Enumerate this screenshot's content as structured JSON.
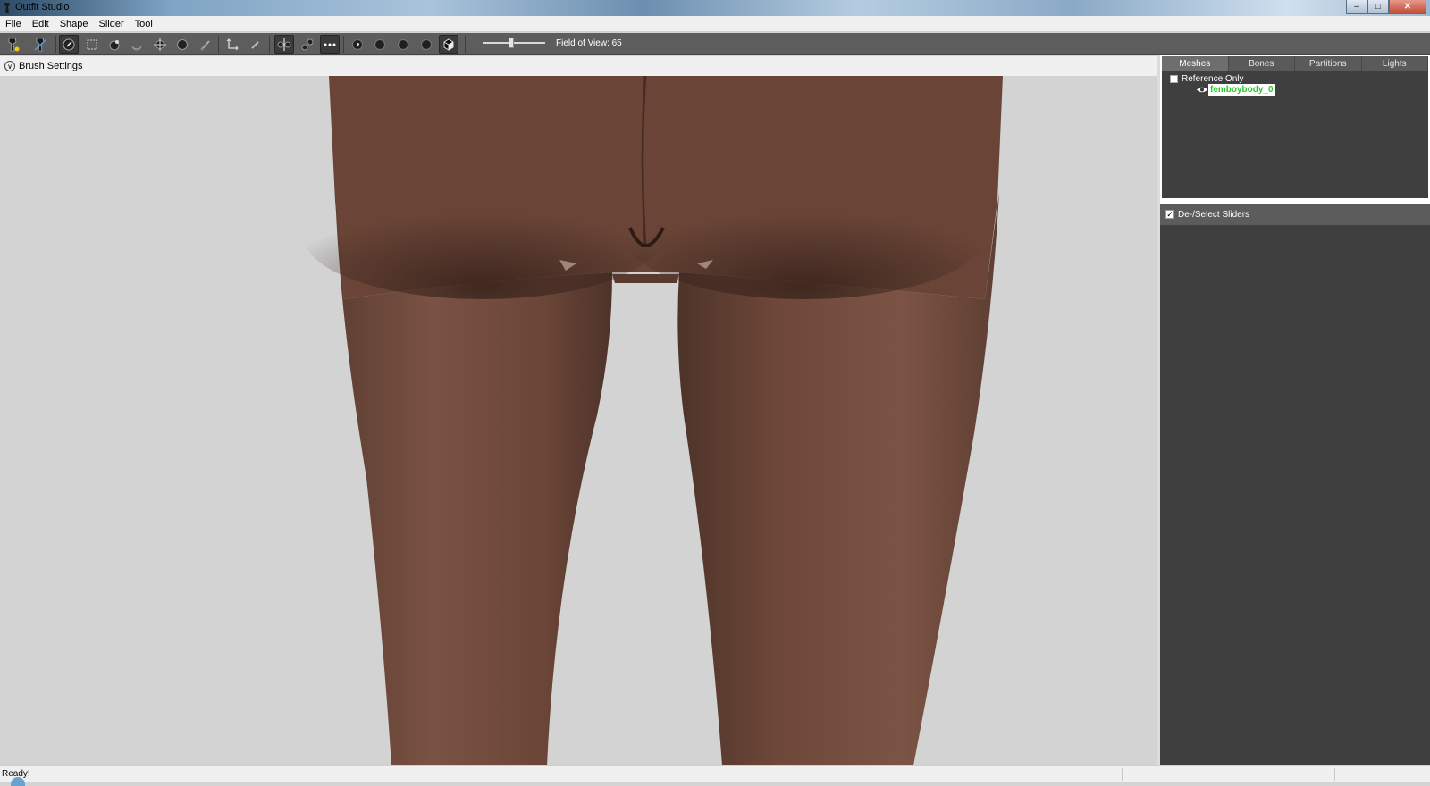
{
  "window": {
    "title": "Outfit Studio",
    "title_suffix": ""
  },
  "menu": [
    "File",
    "Edit",
    "Shape",
    "Slider",
    "Tool"
  ],
  "toolbar": {
    "field_of_view_label": "Field of View: 65",
    "field_of_view_value": 65,
    "tools": [
      "brush-toolbar-icon",
      "select-brush-icon",
      "mask-brush-icon",
      "inflate-brush-icon",
      "deflate-brush-icon",
      "move-brush-icon",
      "smooth-brush-icon",
      "weight-brush-icon",
      "transform-icon",
      "pivot-icon",
      "x-mirror-icon",
      "connected-only-icon",
      "show-vertices-icon",
      "dot-small-icon",
      "dot-medium-icon",
      "dot-large-icon",
      "dot-xl-icon",
      "wireframe-icon"
    ]
  },
  "brush_settings": {
    "label": "Brush Settings"
  },
  "right_panel": {
    "tabs": [
      "Meshes",
      "Bones",
      "Partitions",
      "Lights"
    ],
    "active_tab": "Meshes",
    "tree": {
      "root_label": "Reference Only",
      "mesh_name": "femboybody_0"
    },
    "sliders_header": "De-/Select Sliders",
    "sliders_checked": true
  },
  "status": {
    "text": "Ready!"
  },
  "colors": {
    "toolbar_bg": "#5d5d5d",
    "panel_bg": "#3f3f3f",
    "mesh_highlight": "#2ec42e",
    "viewport_bg": "#d3d3d3",
    "skin": "#7a5244"
  }
}
